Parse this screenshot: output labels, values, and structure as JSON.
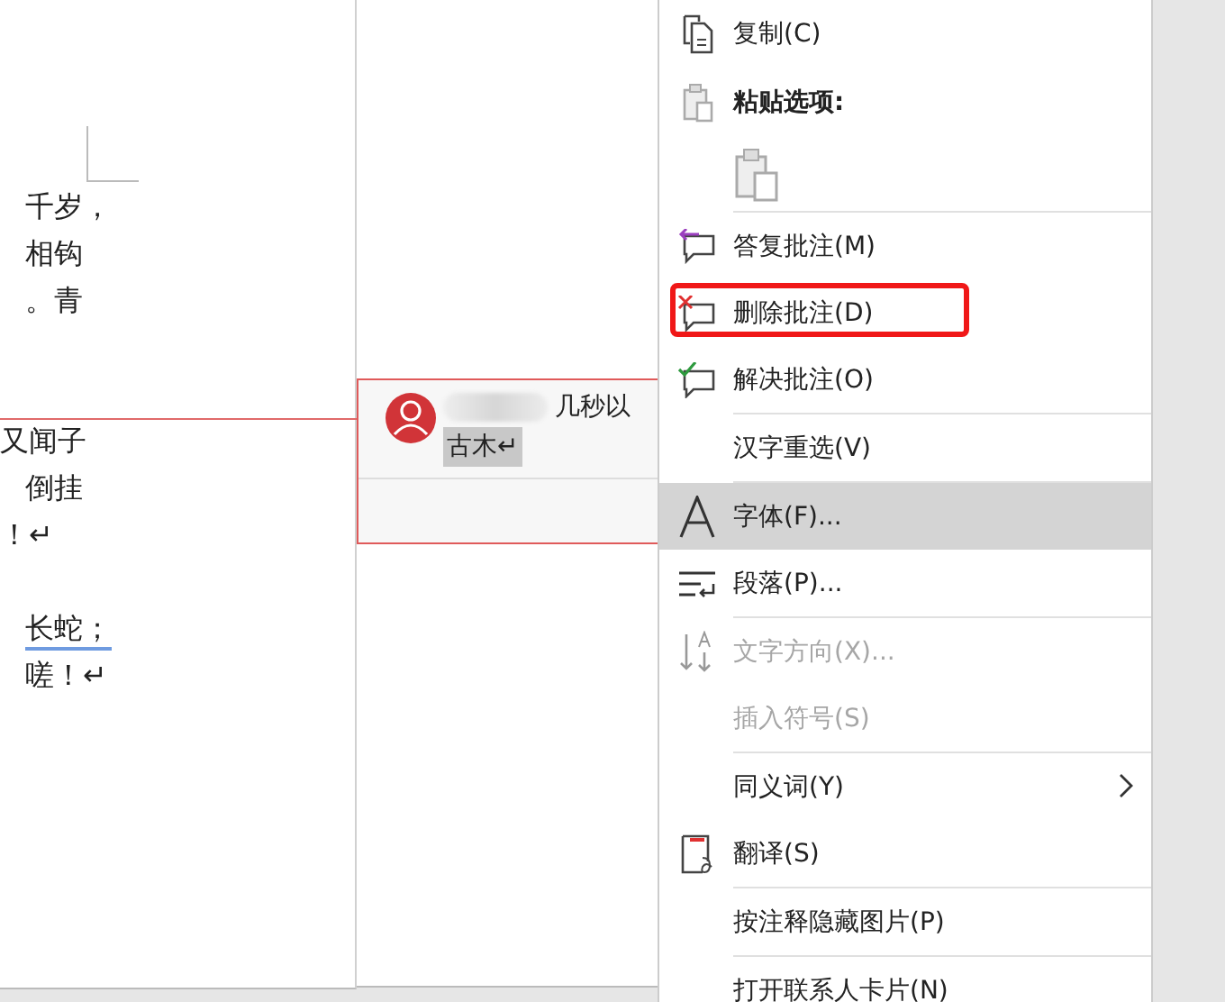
{
  "document": {
    "lines": [
      {
        "text": "千岁，",
        "underlined": false
      },
      {
        "text": "相钩",
        "underlined": false
      },
      {
        "text": "。青",
        "underlined": false
      },
      {
        "text": "又闻子",
        "underlined": false
      },
      {
        "text": "倒挂",
        "underlined": false
      },
      {
        "text": "！↵",
        "underlined": false
      },
      {
        "text": "长蛇；",
        "underlined": true
      },
      {
        "text": "嗟！↵",
        "underlined": false
      }
    ]
  },
  "comment": {
    "time": "几秒以",
    "text": "古木↵"
  },
  "context_menu": {
    "items": [
      {
        "kind": "command",
        "label": "复制(C)",
        "disabled": false,
        "selected": false,
        "highlighted": false,
        "submenu": false
      },
      {
        "kind": "heading",
        "label": "粘贴选项:"
      },
      {
        "kind": "paste_options"
      },
      {
        "kind": "separator"
      },
      {
        "kind": "command",
        "label": "答复批注(M)",
        "disabled": false,
        "selected": false,
        "highlighted": false,
        "submenu": false
      },
      {
        "kind": "command",
        "label": "删除批注(D)",
        "disabled": false,
        "selected": false,
        "highlighted": true,
        "submenu": false
      },
      {
        "kind": "command",
        "label": "解决批注(O)",
        "disabled": false,
        "selected": false,
        "highlighted": false,
        "submenu": false
      },
      {
        "kind": "separator"
      },
      {
        "kind": "command",
        "label": "汉字重选(V)",
        "disabled": false,
        "selected": false,
        "highlighted": false,
        "submenu": false
      },
      {
        "kind": "separator"
      },
      {
        "kind": "command",
        "label": "字体(F)...",
        "disabled": false,
        "selected": true,
        "highlighted": false,
        "submenu": false
      },
      {
        "kind": "command",
        "label": "段落(P)...",
        "disabled": false,
        "selected": false,
        "highlighted": false,
        "submenu": false
      },
      {
        "kind": "separator"
      },
      {
        "kind": "command",
        "label": "文字方向(X)...",
        "disabled": true,
        "selected": false,
        "highlighted": false,
        "submenu": false
      },
      {
        "kind": "command",
        "label": "插入符号(S)",
        "disabled": true,
        "selected": false,
        "highlighted": false,
        "submenu": false
      },
      {
        "kind": "separator"
      },
      {
        "kind": "command",
        "label": "同义词(Y)",
        "disabled": false,
        "selected": false,
        "highlighted": false,
        "submenu": true
      },
      {
        "kind": "command",
        "label": "翻译(S)",
        "disabled": false,
        "selected": false,
        "highlighted": false,
        "submenu": false
      },
      {
        "kind": "separator"
      },
      {
        "kind": "command",
        "label": "按注释隐藏图片(P)",
        "disabled": false,
        "selected": false,
        "highlighted": false,
        "submenu": false
      },
      {
        "kind": "separator"
      },
      {
        "kind": "command",
        "label": "打开联系人卡片(N)",
        "disabled": false,
        "selected": false,
        "highlighted": false,
        "submenu": false
      }
    ]
  }
}
